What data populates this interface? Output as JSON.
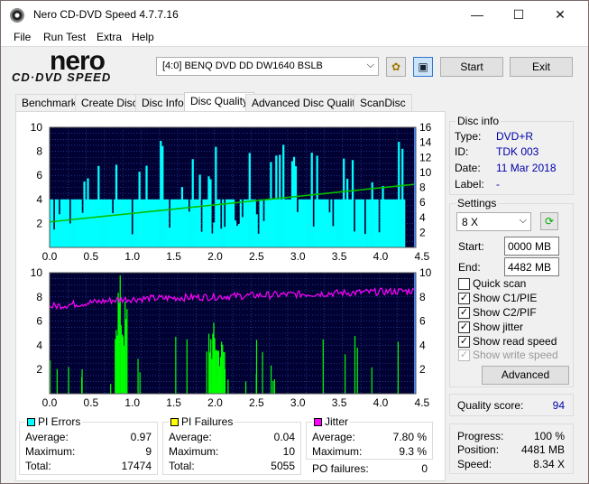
{
  "window": {
    "title": "Nero CD-DVD Speed 4.7.7.16",
    "minimize": "—",
    "maximize": "☐",
    "close": "✕"
  },
  "menu": [
    "File",
    "Run Test",
    "Extra",
    "Help"
  ],
  "logo": {
    "line1": "nero",
    "line2": "CD·DVD SPEED"
  },
  "toolbar": {
    "drive": "[4:0]  BENQ DVD DD DW1640 BSLB",
    "start": "Start",
    "exit": "Exit"
  },
  "tabs": [
    "Benchmark",
    "Create Disc",
    "Disc Info",
    "Disc Quality",
    "Advanced Disc Quality",
    "ScanDisc"
  ],
  "active_tab": "Disc Quality",
  "disc_info": {
    "title": "Disc info",
    "type_label": "Type:",
    "type": "DVD+R",
    "id_label": "ID:",
    "id": "TDK 003",
    "date_label": "Date:",
    "date": "11 Mar 2018",
    "label_label": "Label:",
    "label": "-"
  },
  "settings": {
    "title": "Settings",
    "speed": "8 X",
    "start_label": "Start:",
    "start": "0000 MB",
    "end_label": "End:",
    "end": "4482 MB",
    "quick_scan": "Quick scan",
    "show_c1": "Show C1/PIE",
    "show_c2": "Show C2/PIF",
    "show_jitter": "Show jitter",
    "show_read": "Show read speed",
    "show_write": "Show write speed",
    "advanced": "Advanced"
  },
  "quality": {
    "label": "Quality score:",
    "value": "94"
  },
  "progress": {
    "progress_label": "Progress:",
    "progress": "100 %",
    "position_label": "Position:",
    "position": "4481 MB",
    "speed_label": "Speed:",
    "speed": "8.34 X"
  },
  "pi_errors": {
    "title": "PI Errors",
    "color": "#00ffff",
    "avg_label": "Average:",
    "avg": "0.97",
    "max_label": "Maximum:",
    "max": "9",
    "total_label": "Total:",
    "total": "17474"
  },
  "pi_failures": {
    "title": "PI Failures",
    "color": "#ffff00",
    "avg_label": "Average:",
    "avg": "0.04",
    "max_label": "Maximum:",
    "max": "10",
    "total_label": "Total:",
    "total": "5055"
  },
  "jitter": {
    "title": "Jitter",
    "color": "#ff00ff",
    "avg_label": "Average:",
    "avg": "7.80 %",
    "max_label": "Maximum:",
    "max": "9.3 %",
    "po_label": "PO failures:",
    "po": "0"
  },
  "chart_data": [
    {
      "type": "bar",
      "name": "PI Errors / read speed",
      "x_ticks": [
        "0.0",
        "0.5",
        "1.0",
        "1.5",
        "2.0",
        "2.5",
        "3.0",
        "3.5",
        "4.0",
        "4.5"
      ],
      "y_left_ticks": [
        "2",
        "4",
        "6",
        "8",
        "10"
      ],
      "y_right_ticks": [
        "2",
        "4",
        "6",
        "8",
        "10",
        "12",
        "14",
        "16"
      ],
      "xlim": [
        0,
        4.5
      ],
      "ylim_left": [
        0,
        10
      ],
      "ylim_right": [
        0,
        16
      ],
      "series": [
        {
          "name": "PI Errors",
          "color": "#00ffff",
          "baseline": 4,
          "max": 9
        },
        {
          "name": "Read speed",
          "color": "#00c000",
          "x": [
            0.0,
            4.48
          ],
          "y": [
            3.4,
            8.4
          ]
        }
      ]
    },
    {
      "type": "bar",
      "name": "PI Failures / jitter",
      "x_ticks": [
        "0.0",
        "0.5",
        "1.0",
        "1.5",
        "2.0",
        "2.5",
        "3.0",
        "3.5",
        "4.0",
        "4.5"
      ],
      "y_left_ticks": [
        "2",
        "4",
        "6",
        "8",
        "10"
      ],
      "y_right_ticks": [
        "2",
        "4",
        "6",
        "8",
        "10"
      ],
      "xlim": [
        0,
        4.5
      ],
      "ylim": [
        0,
        10
      ],
      "series": [
        {
          "name": "PI Failures",
          "color": "#00ff00",
          "clusters": [
            [
              0.8,
              0.95,
              10
            ],
            [
              1.95,
              2.15,
              6
            ]
          ]
        },
        {
          "name": "Jitter",
          "color": "#ff00ff",
          "x": [
            0.0,
            0.9,
            4.48
          ],
          "y": [
            7.2,
            7.8,
            8.5
          ]
        }
      ]
    }
  ]
}
